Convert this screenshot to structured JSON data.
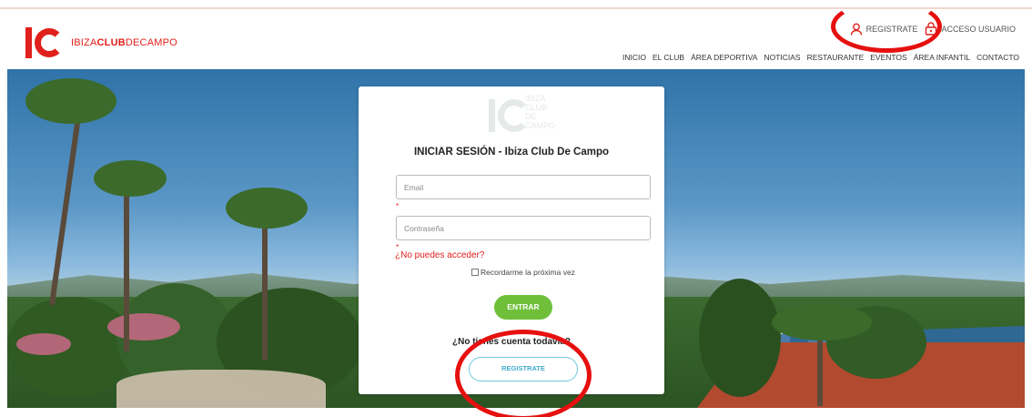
{
  "brand": {
    "name_thin": "IBIZA",
    "name_bold": "CLUB",
    "name_thin2": "DECAMPO",
    "color": "#e0201b"
  },
  "account": {
    "register_label": "REGISTRATE",
    "login_label": "ACCESO USUARIO"
  },
  "nav": {
    "items": [
      "INICIO",
      "EL CLUB",
      "ÁREA DEPORTIVA",
      "NOTICIAS",
      "RESTAURANTE",
      "EVENTOS",
      "ÁREA INFANTIL",
      "CONTACTO"
    ]
  },
  "login": {
    "logo_lines": [
      "IBIZA",
      "CLUB",
      "DE",
      "CAMPO"
    ],
    "title": "INICIAR SESIÓN - Ibiza Club De Campo",
    "email_placeholder": "Email",
    "password_placeholder": "Contraseña",
    "required_mark": "*",
    "forgot_link": "¿No puedes acceder?",
    "remember_label": "Recordarme la próxima vez",
    "submit_label": "ENTRAR",
    "no_account_text": "¿No tienes cuenta todavía?",
    "register_button": "REGISTRATE"
  },
  "colors": {
    "accent_red": "#e0201b",
    "button_green": "#6fbf3a",
    "register_blue": "#42aacd",
    "annotation_red": "#e6100f"
  }
}
